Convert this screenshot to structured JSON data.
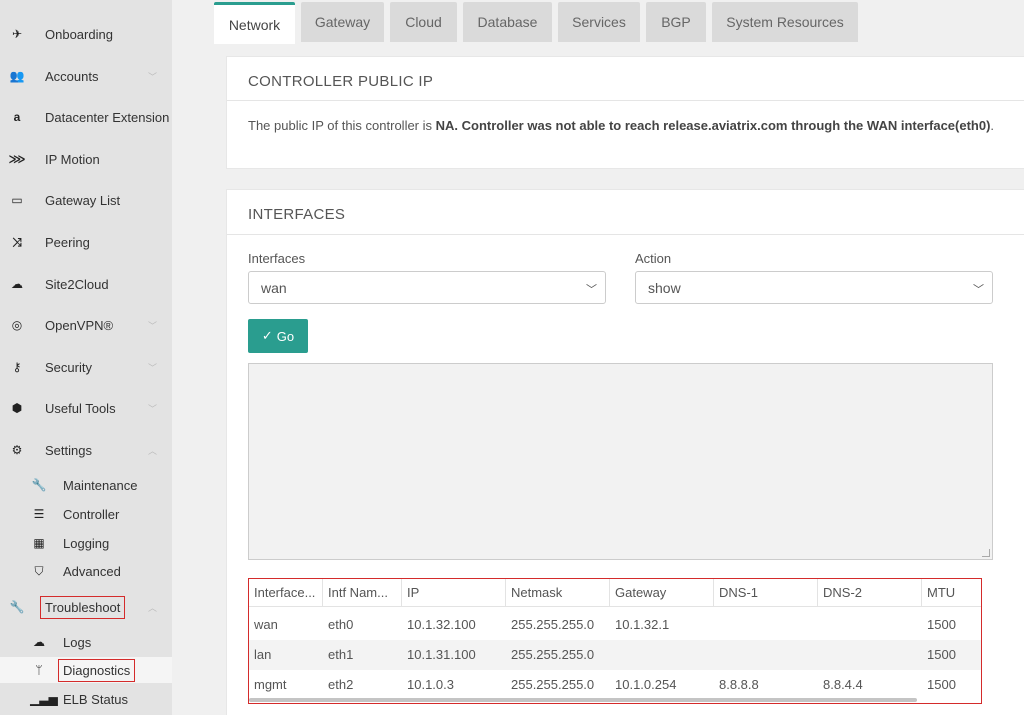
{
  "sidebar": {
    "items": [
      {
        "label": "Onboarding",
        "icon": "plane-icon"
      },
      {
        "label": "Accounts",
        "icon": "users-icon"
      },
      {
        "label": "Datacenter Extension",
        "icon": "amazon-icon"
      },
      {
        "label": "IP Motion",
        "icon": "ip-motion-icon"
      },
      {
        "label": "Gateway List",
        "icon": "monitor-icon"
      },
      {
        "label": "Peering",
        "icon": "shuffle-icon"
      },
      {
        "label": "Site2Cloud",
        "icon": "cloud-upload-icon"
      },
      {
        "label": "OpenVPN®",
        "icon": "wifi-icon"
      },
      {
        "label": "Security",
        "icon": "key-icon"
      },
      {
        "label": "Useful Tools",
        "icon": "cube-icon"
      },
      {
        "label": "Settings",
        "icon": "gear-icon"
      }
    ],
    "settings_sub": [
      {
        "label": "Maintenance",
        "icon": "wrench-icon"
      },
      {
        "label": "Controller",
        "icon": "server-icon"
      },
      {
        "label": "Logging",
        "icon": "table-icon"
      },
      {
        "label": "Advanced",
        "icon": "shield-icon"
      }
    ],
    "troubleshoot": {
      "label": "Troubleshoot",
      "icon": "wrench-icon"
    },
    "troubleshoot_sub": [
      {
        "label": "Logs",
        "icon": "cloud-download-icon"
      },
      {
        "label": "Diagnostics",
        "icon": "stethoscope-icon"
      },
      {
        "label": "ELB Status",
        "icon": "signal-icon"
      }
    ]
  },
  "tabs": [
    "Network",
    "Gateway",
    "Cloud",
    "Database",
    "Services",
    "BGP",
    "System Resources"
  ],
  "public_ip": {
    "title": "CONTROLLER PUBLIC IP",
    "text_prefix": "The public IP of this controller is ",
    "text_bold": "NA. Controller was not able to reach release.aviatrix.com through the WAN interface(eth0)",
    "text_suffix": "."
  },
  "interfaces": {
    "title": "INTERFACES",
    "interfaces_label": "Interfaces",
    "interfaces_value": "wan",
    "action_label": "Action",
    "action_value": "show",
    "go_label": "Go"
  },
  "table": {
    "columns": [
      "Interface...",
      "Intf Nam...",
      "IP",
      "Netmask",
      "Gateway",
      "DNS-1",
      "DNS-2",
      "MTU"
    ],
    "rows": [
      [
        "wan",
        "eth0",
        "10.1.32.100",
        "255.255.255.0",
        "10.1.32.1",
        "",
        "",
        "1500"
      ],
      [
        "lan",
        "eth1",
        "10.1.31.100",
        "255.255.255.0",
        "",
        "",
        "",
        "1500"
      ],
      [
        "mgmt",
        "eth2",
        "10.1.0.3",
        "255.255.255.0",
        "10.1.0.254",
        "8.8.8.8",
        "8.8.4.4",
        "1500"
      ]
    ]
  },
  "colors": {
    "accent": "#2a9d8f",
    "highlight": "#d42b2b"
  }
}
